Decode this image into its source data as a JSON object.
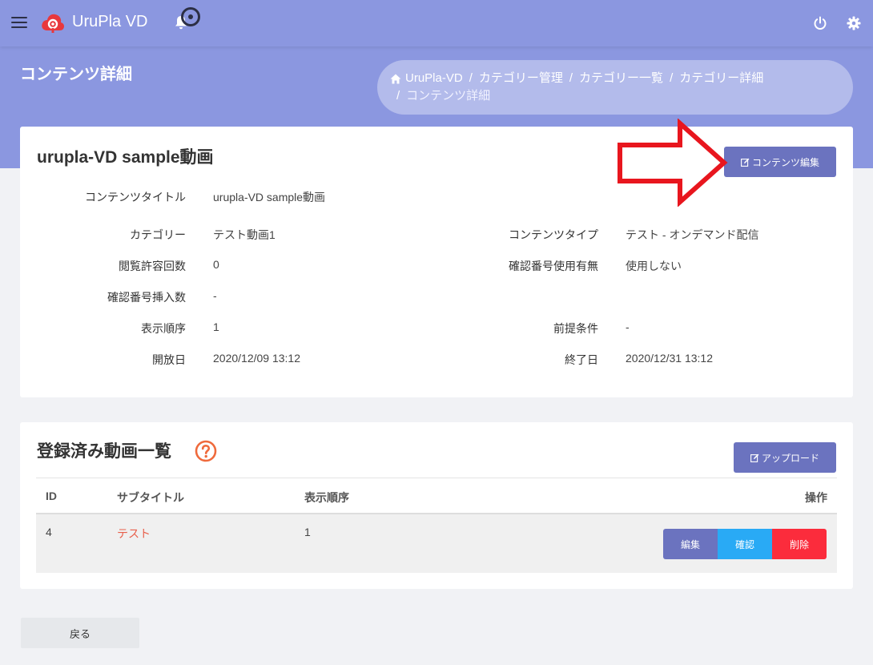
{
  "app": {
    "title": "UruPla VD",
    "brand_color": "#8b97e0"
  },
  "page": {
    "heading": "コンテンツ詳細"
  },
  "breadcrumb": {
    "items": [
      "UruPla-VD",
      "カテゴリー管理",
      "カテゴリー一覧",
      "カテゴリー詳細",
      "コンテンツ詳細"
    ]
  },
  "content_detail": {
    "title": "urupla-VD sample動画",
    "edit_button": "コンテンツ編集",
    "fields": {
      "content_title": {
        "label": "コンテンツタイトル",
        "value": "urupla-VD sample動画"
      },
      "category": {
        "label": "カテゴリー",
        "value": "テスト動画1"
      },
      "content_type": {
        "label": "コンテンツタイプ",
        "value": "テスト - オンデマンド配信"
      },
      "view_limit": {
        "label": "閲覧許容回数",
        "value": "0"
      },
      "confirm_code_usage": {
        "label": "確認番号使用有無",
        "value": "使用しない"
      },
      "confirm_code_insert": {
        "label": "確認番号挿入数",
        "value": "-"
      },
      "display_order": {
        "label": "表示順序",
        "value": "1"
      },
      "prerequisite": {
        "label": "前提条件",
        "value": "-"
      },
      "open_date": {
        "label": "開放日",
        "value": "2020/12/09 13:12"
      },
      "end_date": {
        "label": "終了日",
        "value": "2020/12/31 13:12"
      }
    }
  },
  "video_list": {
    "title": "登録済み動画一覧",
    "upload_button": "アップロード",
    "columns": {
      "id": "ID",
      "subtitle": "サブタイトル",
      "order": "表示順序",
      "actions": "操作"
    },
    "rows": [
      {
        "id": "4",
        "subtitle": "テスト",
        "order": "1"
      }
    ],
    "row_actions": {
      "edit": "編集",
      "confirm": "確認",
      "delete": "削除"
    }
  },
  "footer": {
    "back_button": "戻る"
  },
  "colors": {
    "primary_button": "#6b73bf",
    "confirm_button": "#29aaf5",
    "delete_button": "#fb2c3c",
    "link": "#e8604c",
    "annotation_arrow": "#e8161e"
  }
}
